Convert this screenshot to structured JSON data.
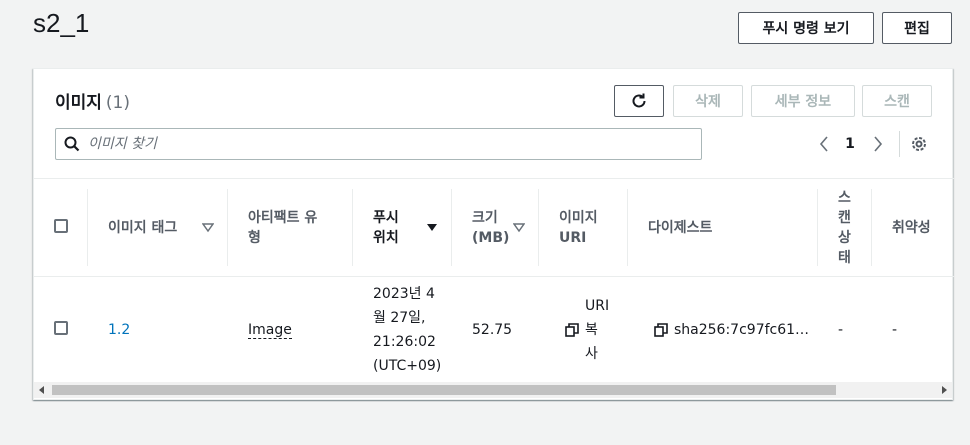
{
  "page": {
    "title": "s2_1"
  },
  "header_buttons": {
    "view_push": "푸시 명령 보기",
    "edit": "편집"
  },
  "panel": {
    "title": "이미지",
    "count": "(1)",
    "actions": {
      "delete": "삭제",
      "details": "세부 정보",
      "scan": "스캔"
    },
    "search": {
      "placeholder": "이미지 찾기"
    },
    "pagination": {
      "page": "1"
    }
  },
  "table": {
    "columns": {
      "tag": "이미지 태그",
      "artifact_type": "아티팩트 유형",
      "pushed_at": "푸시 위치",
      "size": "크기 (MB)",
      "uri": "이미지 URI",
      "digest": "다이제스트",
      "scan_status": "스캔상태",
      "vulnerabilities": "취약성"
    },
    "rows": [
      {
        "tag": "1.2",
        "artifact_type": "Image",
        "pushed_at": "2023년 4월 27일, 21:26:02 (UTC+09)",
        "size": "52.75",
        "uri": "URI 복사",
        "digest": "sha256:7c97fc61…",
        "scan_status": "-",
        "vulnerabilities": "-"
      }
    ]
  },
  "icons": {
    "refresh": "refresh-icon",
    "search": "search-icon",
    "prev": "chevron-left-icon",
    "next": "chevron-right-icon",
    "settings": "gear-icon",
    "copy": "copy-icon",
    "sort": "sort-caret-icon"
  }
}
